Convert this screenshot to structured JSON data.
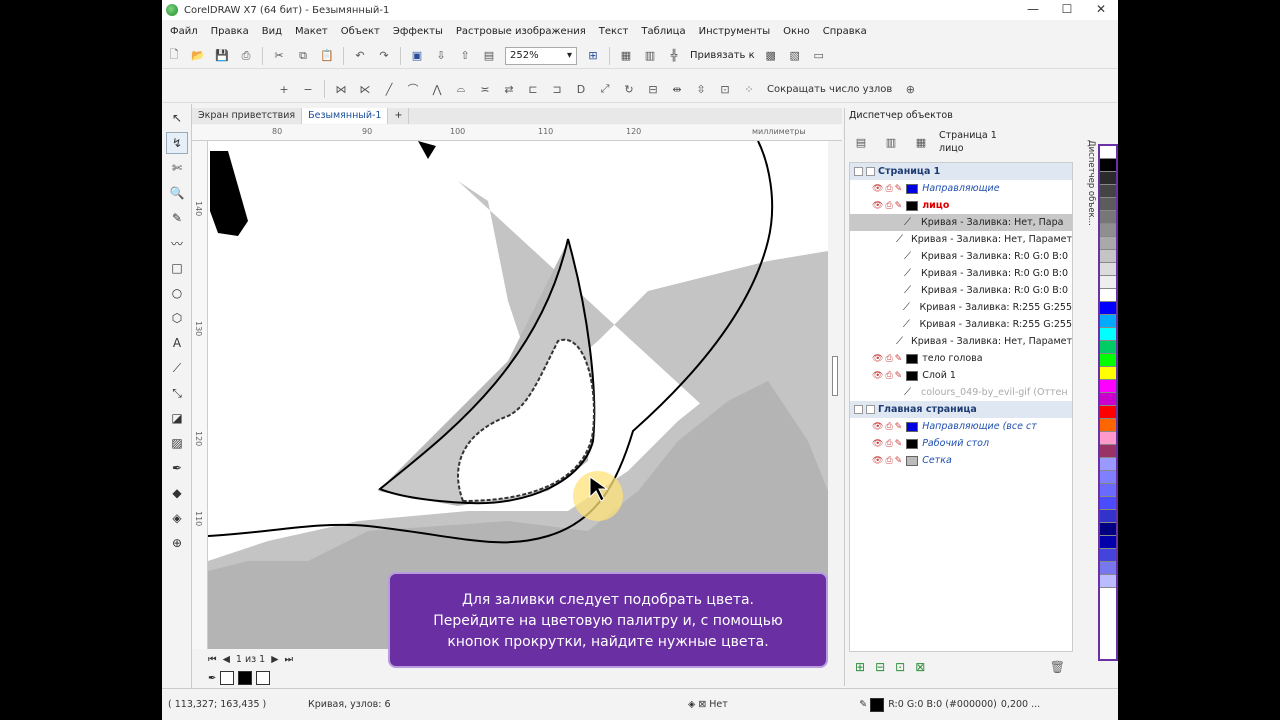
{
  "window": {
    "title": "CorelDRAW X7 (64 бит) - Безымянный-1",
    "min": "—",
    "max": "☐",
    "close": "✕"
  },
  "menu": [
    "Файл",
    "Правка",
    "Вид",
    "Макет",
    "Объект",
    "Эффекты",
    "Растровые изображения",
    "Текст",
    "Таблица",
    "Инструменты",
    "Окно",
    "Справка"
  ],
  "toolbar": {
    "zoom": "252%",
    "snap": "Привязать к",
    "reduce_nodes": "Сокращать число узлов"
  },
  "tabs": [
    "Экран приветствия",
    "Безымянный-1"
  ],
  "ruler": {
    "h": [
      "80",
      "90",
      "100",
      "110",
      "120"
    ],
    "units": "миллиметры",
    "v": [
      "140",
      "130",
      "120",
      "110"
    ]
  },
  "pagenav": {
    "text": "1 из 1"
  },
  "docker": {
    "title": "Диспетчер объектов",
    "page_label": "Страница 1",
    "layer_label": "лицо",
    "rows": [
      {
        "text": "Страница 1",
        "type": "hdr"
      },
      {
        "text": "Направляющие",
        "type": "layer",
        "color": "#0000e0",
        "style": "it-blue"
      },
      {
        "text": "лицо",
        "type": "layer",
        "color": "#000000",
        "style": "red-bold"
      },
      {
        "text": "Кривая - Заливка: Нет, Пара",
        "type": "obj",
        "sel": true
      },
      {
        "text": "Кривая - Заливка: Нет, Парамет",
        "type": "obj"
      },
      {
        "text": "Кривая - Заливка: R:0 G:0 B:0",
        "type": "obj"
      },
      {
        "text": "Кривая - Заливка: R:0 G:0 B:0",
        "type": "obj"
      },
      {
        "text": "Кривая - Заливка: R:0 G:0 B:0",
        "type": "obj"
      },
      {
        "text": "Кривая - Заливка: R:255 G:255",
        "type": "obj"
      },
      {
        "text": "Кривая - Заливка: R:255 G:255",
        "type": "obj"
      },
      {
        "text": "Кривая - Заливка: Нет, Парамет",
        "type": "obj"
      },
      {
        "text": "тело голова",
        "type": "layer",
        "color": "#000000",
        "style": "plain"
      },
      {
        "text": "Слой 1",
        "type": "layer",
        "color": "#000000",
        "style": "plain"
      },
      {
        "text": "colours_049-by_evil-gif (Оттен",
        "type": "obj",
        "faded": true
      },
      {
        "text": "Главная страница",
        "type": "hdr"
      },
      {
        "text": "Направляющие (все ст",
        "type": "layer",
        "color": "#0000e0",
        "style": "it-blue"
      },
      {
        "text": "Рабочий стол",
        "type": "layer",
        "color": "#000000",
        "style": "it-blue"
      },
      {
        "text": "Сетка",
        "type": "layer",
        "color": "#bbbbbb",
        "style": "it-blue"
      }
    ]
  },
  "side_tab": "Диспетчер объек...",
  "palette": [
    "#ffffff",
    "#000000",
    "#2b2b2b",
    "#444444",
    "#5c5c5c",
    "#777777",
    "#8f8f8f",
    "#a9a9a9",
    "#c4c4c4",
    "#dcdcdc",
    "#eeeeee",
    "#ffffff",
    "#0000ff",
    "#00aaff",
    "#00ffff",
    "#00cc66",
    "#00ff00",
    "#ffff00",
    "#ff00ff",
    "#cc00cc",
    "#ff0000",
    "#ff6600",
    "#ff99cc",
    "#993366",
    "#9999ff",
    "#7f7fff",
    "#6a6aff",
    "#4c4cff",
    "#3333cc",
    "#000080",
    "#0000aa",
    "#4444dd",
    "#7777ee",
    "#bbbbff"
  ],
  "status": {
    "coords": "( 113,327; 163,435 )",
    "object": "Кривая, узлов: 6",
    "fill": "Нет",
    "outline": "R:0 G:0 B:0 (#000000)",
    "width": "0,200 ..."
  },
  "overlay": {
    "line1": "Для заливки следует подобрать цвета.",
    "line2": "Перейдите на цветовую палитру и, с помощью",
    "line3": "кнопок прокрутки, найдите нужные цвета."
  }
}
